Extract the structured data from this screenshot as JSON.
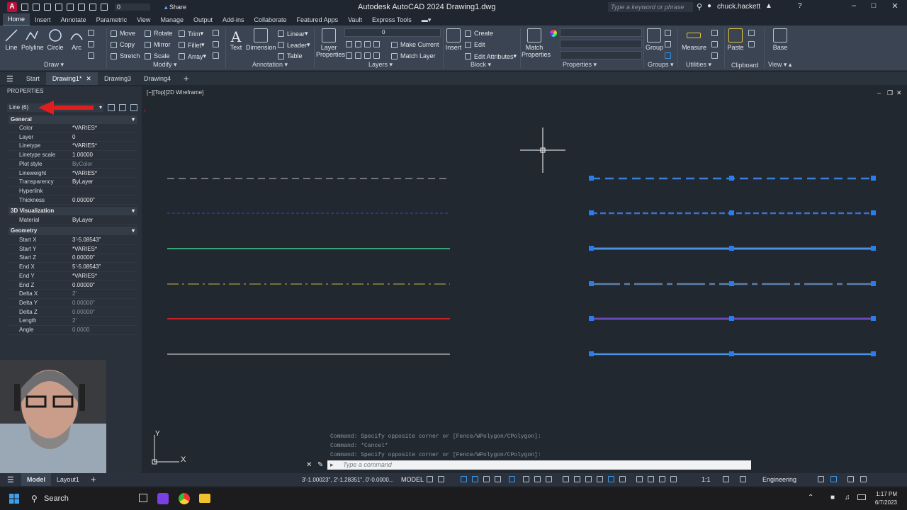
{
  "titlebar": {
    "logo": "A",
    "app_title": "Autodesk AutoCAD 2024  Drawing1.dwg",
    "share_label": "Share",
    "layer_name": "0",
    "search_placeholder": "Type a keyword or phrase",
    "username": "chuck.hackett"
  },
  "ribbon_tabs": [
    "Home",
    "Insert",
    "Annotate",
    "Parametric",
    "View",
    "Manage",
    "Output",
    "Add-ins",
    "Collaborate",
    "Featured Apps",
    "Vault",
    "Express Tools"
  ],
  "ribbon": {
    "draw": {
      "title": "Draw",
      "line": "Line",
      "polyline": "Polyline",
      "circle": "Circle",
      "arc": "Arc"
    },
    "modify": {
      "title": "Modify",
      "move": "Move",
      "rotate": "Rotate",
      "trim": "Trim",
      "copy": "Copy",
      "mirror": "Mirror",
      "fillet": "Fillet",
      "stretch": "Stretch",
      "scale": "Scale",
      "array": "Array"
    },
    "annotation": {
      "title": "Annotation",
      "text": "Text",
      "dimension": "Dimension",
      "linear": "Linear",
      "leader": "Leader",
      "table": "Table"
    },
    "layers": {
      "title": "Layers",
      "layer_properties": "Layer Properties",
      "make_current": "Make Current",
      "match_layer": "Match Layer",
      "layer_value": "0"
    },
    "block": {
      "title": "Block",
      "insert": "Insert",
      "create": "Create",
      "edit": "Edit",
      "edit_attributes": "Edit Attributes"
    },
    "properties": {
      "title": "Properties",
      "match_properties": "Match Properties"
    },
    "groups": {
      "title": "Groups",
      "group": "Group"
    },
    "utilities": {
      "title": "Utilities",
      "measure": "Measure"
    },
    "clipboard": {
      "title": "Clipboard",
      "paste": "Paste"
    },
    "view": {
      "title": "View",
      "base": "Base"
    }
  },
  "file_tabs": [
    "Start",
    "Drawing1*",
    "Drawing3",
    "Drawing4"
  ],
  "properties_palette": {
    "header": "PROPERTIES",
    "selection": "Line (6)",
    "sections": {
      "general": "General",
      "visualization": "3D Visualization",
      "geometry": "Geometry"
    },
    "general_rows": [
      {
        "k": "Color",
        "v": "*VARIES*",
        "dim": false
      },
      {
        "k": "Layer",
        "v": "0",
        "dim": false
      },
      {
        "k": "Linetype",
        "v": "*VARIES*",
        "dim": false
      },
      {
        "k": "Linetype scale",
        "v": "1.00000",
        "dim": false
      },
      {
        "k": "Plot style",
        "v": "ByColor",
        "dim": true
      },
      {
        "k": "Lineweight",
        "v": "*VARIES*",
        "dim": false
      },
      {
        "k": "Transparency",
        "v": "ByLayer",
        "dim": false
      },
      {
        "k": "Hyperlink",
        "v": "",
        "dim": false
      },
      {
        "k": "Thickness",
        "v": "0.00000\"",
        "dim": false
      }
    ],
    "visual_rows": [
      {
        "k": "Material",
        "v": "ByLayer",
        "dim": false
      }
    ],
    "geometry_rows": [
      {
        "k": "Start X",
        "v": "3'-5.08543\"",
        "dim": false
      },
      {
        "k": "Start Y",
        "v": "*VARIES*",
        "dim": false
      },
      {
        "k": "Start Z",
        "v": "0.00000\"",
        "dim": false
      },
      {
        "k": "End X",
        "v": "5'-5.08543\"",
        "dim": false
      },
      {
        "k": "End Y",
        "v": "*VARIES*",
        "dim": false
      },
      {
        "k": "End Z",
        "v": "0.00000\"",
        "dim": false
      },
      {
        "k": "Delta X",
        "v": "2'",
        "dim": true
      },
      {
        "k": "Delta Y",
        "v": "0.00000\"",
        "dim": true
      },
      {
        "k": "Delta Z",
        "v": "0.00000\"",
        "dim": true
      },
      {
        "k": "Length",
        "v": "2'",
        "dim": true
      },
      {
        "k": "Angle",
        "v": "0.0000",
        "dim": true
      }
    ]
  },
  "viewport_label": "[−][Top][2D Wireframe]",
  "command_history": [
    "Command: Specify opposite corner or [Fence/WPolygon/CPolygon]:",
    "Command: *Cancel*",
    "Command: Specify opposite corner or [Fence/WPolygon/CPolygon]:"
  ],
  "command_placeholder": "Type a command",
  "status_bar": {
    "layout_tabs": [
      "Model",
      "Layout1"
    ],
    "coordinates": "3'-1.00023\", 2'-1.28351\", 0'-0.0000...",
    "model_label": "MODEL",
    "scale": "1:1",
    "units": "Engineering"
  },
  "taskbar": {
    "search_label": "Search",
    "time": "1:17 PM",
    "date": "6/7/2023"
  },
  "colors": {
    "accent": "#2e8ee3",
    "selected_line": "#3c7fd8",
    "grip": "#2a7df0",
    "red_arrow": "#e01e1e"
  }
}
